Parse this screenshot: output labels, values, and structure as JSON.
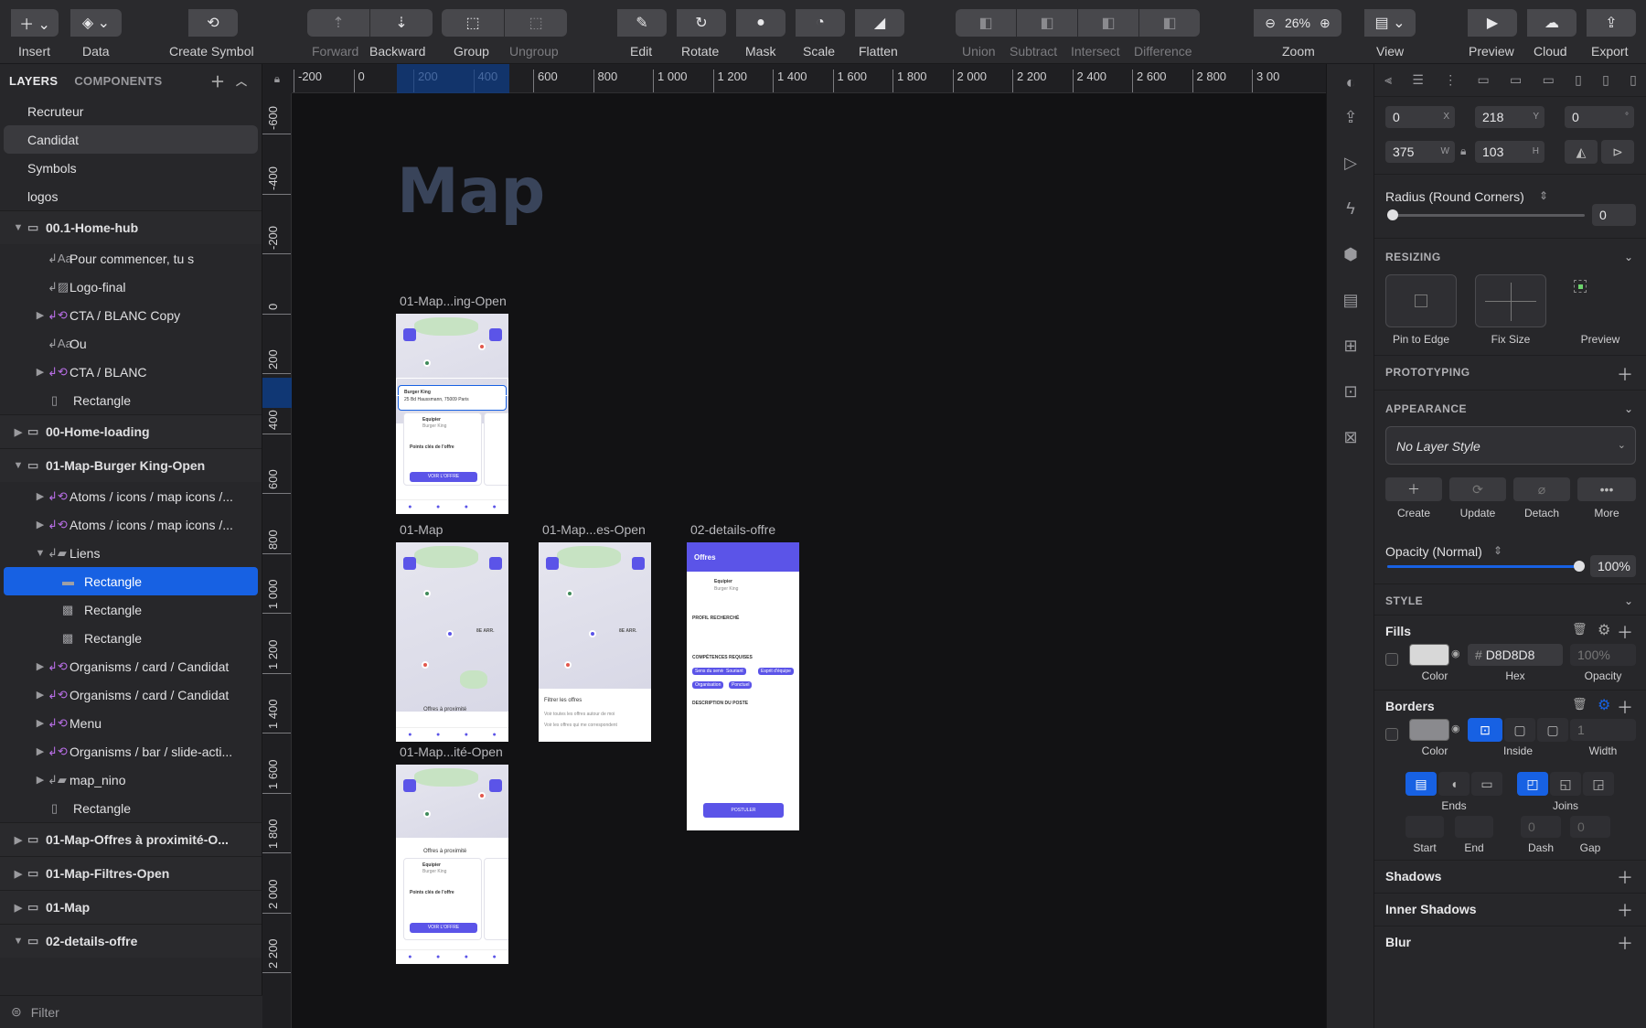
{
  "toolbar": {
    "insert": "Insert",
    "data": "Data",
    "create_symbol": "Create Symbol",
    "forward": "Forward",
    "backward": "Backward",
    "group": "Group",
    "ungroup": "Ungroup",
    "edit": "Edit",
    "rotate": "Rotate",
    "mask": "Mask",
    "scale": "Scale",
    "flatten": "Flatten",
    "union": "Union",
    "subtract": "Subtract",
    "intersect": "Intersect",
    "difference": "Difference",
    "zoom_label": "Zoom",
    "zoom_value": "26%",
    "view": "View",
    "preview": "Preview",
    "cloud": "Cloud",
    "export": "Export"
  },
  "left_panel": {
    "tab_layers": "LAYERS",
    "tab_components": "COMPONENTS",
    "pages": [
      {
        "label": "Recruteur"
      },
      {
        "label": "Candidat",
        "selected": true
      },
      {
        "label": "Symbols"
      },
      {
        "label": "logos"
      }
    ],
    "layers": [
      {
        "kind": "artboard",
        "label": "00.1-Home-hub",
        "open": true
      },
      {
        "kind": "text",
        "label": "Pour commencer, tu s"
      },
      {
        "kind": "image",
        "label": "Logo-final"
      },
      {
        "kind": "symbol",
        "label": "CTA / BLANC Copy"
      },
      {
        "kind": "text",
        "label": "Ou"
      },
      {
        "kind": "symbol",
        "label": "CTA / BLANC"
      },
      {
        "kind": "rect",
        "label": "Rectangle"
      },
      {
        "kind": "artboard",
        "label": "00-Home-loading",
        "open": false
      },
      {
        "kind": "artboard",
        "label": "01-Map-Burger King-Open",
        "open": true
      },
      {
        "kind": "symbol",
        "label": "Atoms / icons / map icons /..."
      },
      {
        "kind": "symbol",
        "label": "Atoms / icons / map icons /..."
      },
      {
        "kind": "folder",
        "label": "Liens",
        "open": true
      },
      {
        "kind": "rectsel",
        "label": "Rectangle",
        "highlighted": true
      },
      {
        "kind": "rectsq",
        "label": "Rectangle"
      },
      {
        "kind": "rectsq",
        "label": "Rectangle"
      },
      {
        "kind": "symbol",
        "label": "Organisms / card / Candidat"
      },
      {
        "kind": "symbol",
        "label": "Organisms / card / Candidat"
      },
      {
        "kind": "symbol",
        "label": "Menu"
      },
      {
        "kind": "symbol",
        "label": "Organisms / bar / slide-acti..."
      },
      {
        "kind": "folder",
        "label": "map_nino"
      },
      {
        "kind": "rect",
        "label": "Rectangle"
      },
      {
        "kind": "artboard",
        "label": "01-Map-Offres à proximité-O...",
        "open": false
      },
      {
        "kind": "artboard",
        "label": "01-Map-Filtres-Open",
        "open": false
      },
      {
        "kind": "artboard",
        "label": "01-Map",
        "open": false
      },
      {
        "kind": "artboard",
        "label": "02-details-offre",
        "open": true
      }
    ],
    "filter_placeholder": "Filter"
  },
  "rulers": {
    "h": [
      "-200",
      "0",
      "200",
      "400",
      "600",
      "800",
      "1 000",
      "1 200",
      "1 400",
      "1 600",
      "1 800",
      "2 000",
      "2 200",
      "2 400",
      "2 600",
      "2 800",
      "3 00"
    ],
    "v": [
      "-600",
      "-400",
      "-200",
      "0",
      "200",
      "400",
      "600",
      "800",
      "1 000",
      "1 200",
      "1 400",
      "1 600",
      "1 800",
      "2 000",
      "2 200"
    ]
  },
  "canvas": {
    "page_title": "Map",
    "artboards": [
      {
        "label": "01-Map...ing-Open"
      },
      {
        "label": "01-Map"
      },
      {
        "label": "01-Map...es-Open"
      },
      {
        "label": "02-details-offre"
      },
      {
        "label": "01-Map...ité-Open"
      }
    ],
    "mock": {
      "place_name": "Burger King",
      "place_address": "25 Bd Haussmann, 75009 Paris",
      "job_title": "Equipier",
      "company": "Burger King",
      "card_heading": "Points clés de l'offre",
      "card_cta": "VOIR L'OFFRE",
      "proximity": "Offres à proximité",
      "filter_title": "Filtrer les offres",
      "filter_opt1": "Voir toutes les offres autour de moi",
      "filter_opt2": "Voir les offres qui me correspondent",
      "details_header": "Offres",
      "details_profile": "PROFIL RECHERCHÉ",
      "details_skills": "COMPÉTENCES REQUISES",
      "details_desc": "DESCRIPTION DU POSTE",
      "details_cta": "POSTULER",
      "skills": [
        "Sens du service",
        "Souriant",
        "Esprit d'équipe",
        "Organisation",
        "Ponctuel"
      ],
      "map_district": "8E ARR."
    }
  },
  "inspector": {
    "x": "0",
    "x_suffix": "X",
    "y": "218",
    "y_suffix": "Y",
    "rotation": "0",
    "rotation_suffix": "°",
    "w": "375",
    "w_suffix": "W",
    "h": "103",
    "h_suffix": "H",
    "radius_label": "Radius (Round Corners)",
    "radius_value": "0",
    "resizing": "RESIZING",
    "pin_to_edge": "Pin to Edge",
    "fix_size": "Fix Size",
    "preview": "Preview",
    "prototyping": "PROTOTYPING",
    "appearance": "APPEARANCE",
    "layer_style": "No Layer Style",
    "create": "Create",
    "update": "Update",
    "detach": "Detach",
    "more": "More",
    "opacity_label": "Opacity (Normal)",
    "opacity_value": "100%",
    "opacity_fraction": 1.0,
    "style": "STYLE",
    "fills": "Fills",
    "fill_hex": "D8D8D8",
    "fill_opacity": "100%",
    "color": "Color",
    "hex": "Hex",
    "opacity": "Opacity",
    "borders": "Borders",
    "border_width": "1",
    "inside": "Inside",
    "width": "Width",
    "ends": "Ends",
    "joins": "Joins",
    "start": "Start",
    "end": "End",
    "dash": "Dash",
    "gap": "Gap",
    "dash_value": "0",
    "gap_value": "0",
    "shadows": "Shadows",
    "inner_shadows": "Inner Shadows",
    "blur": "Blur"
  },
  "colors": {
    "accent": "#1761e3",
    "mock_primary": "#5b54e8",
    "fill": "#D8D8D8"
  }
}
